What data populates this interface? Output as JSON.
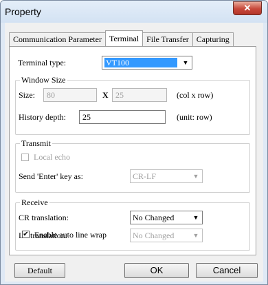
{
  "window": {
    "title": "Property",
    "close_glyph": "✕",
    "close_icon": "close-icon"
  },
  "tabs": [
    {
      "label": "Communication Parameter"
    },
    {
      "label": "Terminal"
    },
    {
      "label": "File Transfer"
    },
    {
      "label": "Capturing"
    }
  ],
  "terminal": {
    "type_label": "Terminal type:",
    "type_value": "VT100",
    "window_size": {
      "legend": "Window Size",
      "size_label": "Size:",
      "cols": "80",
      "x_label": "X",
      "rows": "25",
      "units": "(col x row)",
      "history_label": "History depth:",
      "history_value": "25",
      "history_units": "(unit: row)"
    },
    "transmit": {
      "legend": "Transmit",
      "local_echo_label": "Local echo",
      "local_echo_checked": false,
      "send_enter_label": "Send 'Enter' key as:",
      "send_enter_value": "CR-LF"
    },
    "receive": {
      "legend": "Receive",
      "cr_label": "CR translation:",
      "cr_value": "No Changed",
      "lf_label": "LF translation:",
      "lf_value": "No Changed"
    },
    "auto_wrap_label": "Enable auto line wrap",
    "auto_wrap_checked": true,
    "check_glyph": "✔"
  },
  "buttons": {
    "default": "Default",
    "ok": "OK",
    "cancel": "Cancel"
  },
  "icons": {
    "dropdown": "▼"
  }
}
